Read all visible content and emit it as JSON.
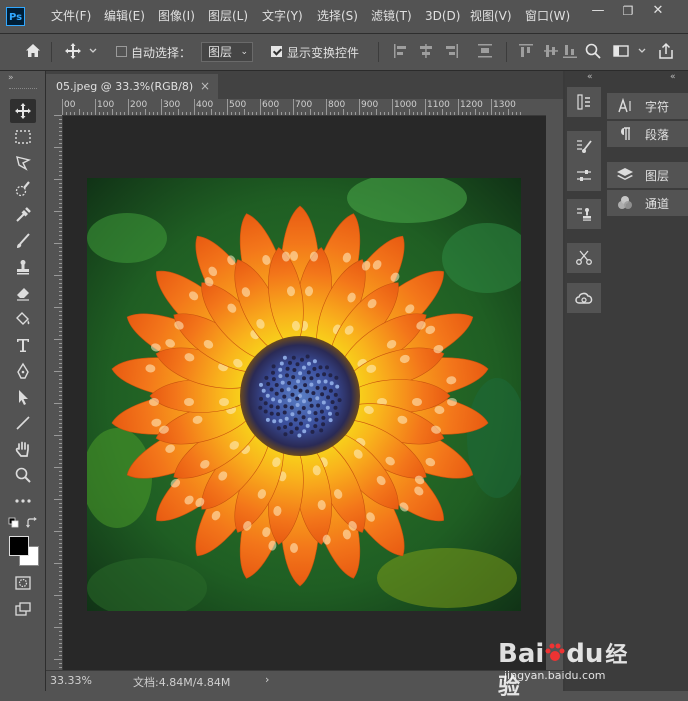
{
  "app": {
    "logo_text": "Ps"
  },
  "menu": {
    "items": [
      "文件(F)",
      "编辑(E)",
      "图像(I)",
      "图层(L)",
      "文字(Y)",
      "选择(S)",
      "滤镜(T)",
      "3D(D)",
      "视图(V)",
      "窗口(W)"
    ]
  },
  "window_controls": {
    "minimize": "—",
    "maximize": "❐",
    "close": "✕"
  },
  "options": {
    "auto_select_label": "自动选择：",
    "auto_select_checked": false,
    "target_value": "图层",
    "show_transform_label": "显示变换控件",
    "show_transform_checked": true
  },
  "document": {
    "tab_title": "05.jpeg @ 33.3%(RGB/8)",
    "close_glyph": "×"
  },
  "ruler": {
    "labels": [
      "00",
      "100",
      "200",
      "300",
      "400",
      "500",
      "600",
      "700",
      "800",
      "900",
      "1000",
      "1100",
      "1200",
      "1300"
    ]
  },
  "status": {
    "zoom": "33.33%",
    "doc_info": "文档:4.84M/4.84M",
    "arrow": "›"
  },
  "panels": {
    "items": [
      {
        "label": "字符",
        "icon": "character-icon"
      },
      {
        "label": "段落",
        "icon": "paragraph-icon"
      },
      {
        "label": "图层",
        "icon": "layers-icon"
      },
      {
        "label": "通道",
        "icon": "channels-icon"
      }
    ]
  },
  "watermark": {
    "brand": "Bai",
    "brand2": "du",
    "cn": "经验",
    "url": "jingyan.baidu.com"
  },
  "colors": {
    "foreground": "#000000",
    "background": "#ffffff",
    "accent": "#31a8ff"
  }
}
